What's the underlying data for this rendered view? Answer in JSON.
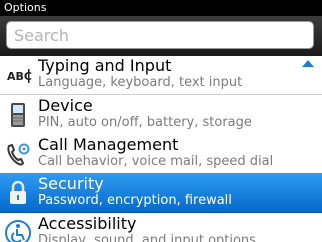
{
  "window": {
    "title": "Options"
  },
  "search": {
    "placeholder": "Search",
    "value": ""
  },
  "list": {
    "items": [
      {
        "label": "Typing and Input",
        "sub": "Language, keyboard, text input",
        "icon": "abc-keyboard-icon"
      },
      {
        "label": "Device",
        "sub": "PIN, auto on/off, battery, storage",
        "icon": "device-icon"
      },
      {
        "label": "Call Management",
        "sub": "Call behavior, voice mail, speed dial",
        "icon": "phone-settings-icon"
      },
      {
        "label": "Security",
        "sub": "Password, encryption, firewall",
        "icon": "lock-icon",
        "selected": true
      },
      {
        "label": "Accessibility",
        "sub": "Display, sound, and input options",
        "icon": "accessibility-icon"
      }
    ]
  },
  "colors": {
    "selection": "#1a86e6",
    "scroll_arrow": "#1e7ed6"
  }
}
